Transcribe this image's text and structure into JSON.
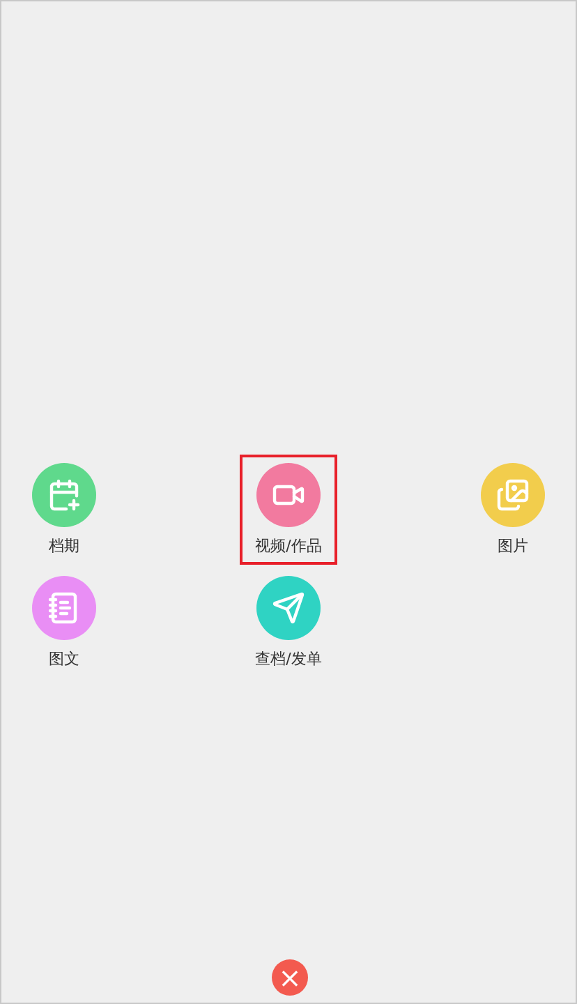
{
  "menu": [
    {
      "label": "档期",
      "color": "#5fd98c",
      "selected": false
    },
    {
      "label": "视频/作品",
      "color": "#f27a9f",
      "selected": true
    },
    {
      "label": "图片",
      "color": "#f2cd4c",
      "selected": false
    },
    {
      "label": "图文",
      "color": "#e98ef5",
      "selected": false
    },
    {
      "label": "查档/发单",
      "color": "#2fd3c3",
      "selected": false
    }
  ],
  "close": "×"
}
